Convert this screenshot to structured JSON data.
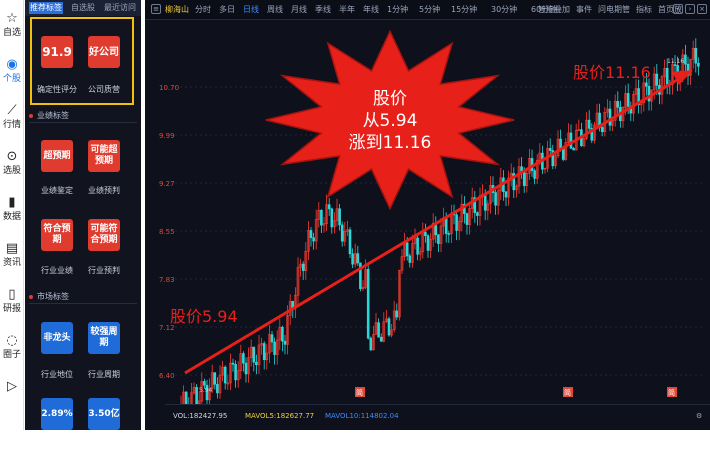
{
  "nav": [
    {
      "label": "自选",
      "icon": "star-icon",
      "glyph": "☆"
    },
    {
      "label": "个股",
      "icon": "stock-icon",
      "glyph": "◉"
    },
    {
      "label": "行情",
      "icon": "chart-line-icon",
      "glyph": "⟋"
    },
    {
      "label": "选股",
      "icon": "filter-icon",
      "glyph": "⊙"
    },
    {
      "label": "数据",
      "icon": "bar-chart-icon",
      "glyph": "▮"
    },
    {
      "label": "资讯",
      "icon": "news-icon",
      "glyph": "▤"
    },
    {
      "label": "研报",
      "icon": "report-icon",
      "glyph": "▯"
    },
    {
      "label": "圈子",
      "icon": "chat-icon",
      "glyph": "◌"
    },
    {
      "label": "",
      "icon": "video-icon",
      "glyph": "▷"
    }
  ],
  "panel": {
    "tabs": [
      "推荐标签",
      "自选股",
      "最近访问"
    ],
    "top_cards": [
      {
        "value": "91.9",
        "caption": "确定性评分"
      },
      {
        "value": "好公司",
        "caption": "公司质营"
      }
    ],
    "sec1": "业绩标签",
    "sec1_cards": [
      {
        "value": "超预期",
        "caption": "业绩鉴定"
      },
      {
        "value": "可能超预期",
        "caption": "业绩预判"
      },
      {
        "value": "符合预期",
        "caption": "行业业绩"
      },
      {
        "value": "可能符合预期",
        "caption": "行业预判"
      }
    ],
    "sec2": "市场标签",
    "sec2_cards": [
      {
        "value": "非龙头",
        "caption": "行业地位"
      },
      {
        "value": "较强周期",
        "caption": "行业周期"
      },
      {
        "value": "2.89%",
        "caption": ""
      },
      {
        "value": "3.50亿",
        "caption": ""
      }
    ]
  },
  "toolbar": {
    "stock": "柳海山",
    "periods": [
      "分时",
      "多日",
      "日线",
      "周线",
      "月线",
      "季线",
      "半年",
      "年线",
      "1分钟",
      "5分钟",
      "15分钟",
      "30分钟",
      "60分钟"
    ],
    "active": "日线",
    "right": [
      "智能叠加",
      "事件",
      "问电期管",
      "指标",
      "首页放"
    ]
  },
  "chart_data": {
    "type": "candlestick",
    "y_ticks": [
      "10.70",
      "9.99",
      "9.27",
      "8.55",
      "7.83",
      "7.12",
      "6.40"
    ],
    "start_low_label": "5.94",
    "end_high_label": "11.16",
    "annotation_left": "股价5.94",
    "annotation_right": "股价11.16",
    "burst_text": [
      "股价",
      "从5.94",
      "涨到11.16"
    ],
    "event_marker": "简",
    "colors": {
      "up": "#ff3b30",
      "down": "#28d8d8",
      "arrow": "#e8201a",
      "burst": "#e8201a",
      "burst_text": "#ffffff"
    }
  },
  "volume": {
    "label1": "VOL:182427.95",
    "label2": "MAVOL5:182627.77",
    "label3": "MAVOL10:114802.04"
  }
}
